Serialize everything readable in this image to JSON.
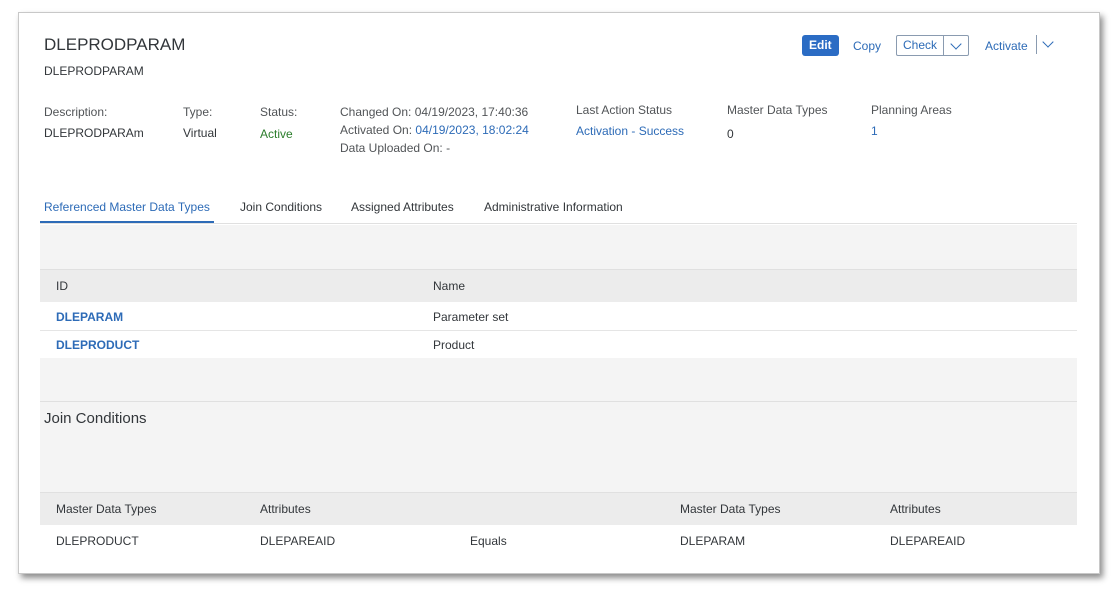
{
  "header": {
    "title": "DLEPRODPARAM",
    "subtitle": "DLEPRODPARAM"
  },
  "actions": {
    "edit": "Edit",
    "copy": "Copy",
    "check": "Check",
    "activate": "Activate"
  },
  "attributes": {
    "description_label": "Description:",
    "description_value": "DLEPRODPARAm",
    "type_label": "Type:",
    "type_value": "Virtual",
    "status_label": "Status:",
    "status_value": "Active",
    "changed_label": "Changed On:",
    "changed_value": "04/19/2023, 17:40:36",
    "activated_label": "Activated On:",
    "activated_value": "04/19/2023, 18:02:24",
    "uploaded_label": "Data Uploaded On:",
    "uploaded_value": "-",
    "last_action_label": "Last Action Status",
    "last_action_value": "Activation - Success",
    "mdt_label": "Master Data Types",
    "mdt_value": "0",
    "planning_label": "Planning Areas",
    "planning_value": "1"
  },
  "tabs": [
    {
      "label": "Referenced Master Data Types",
      "selected": true
    },
    {
      "label": "Join Conditions",
      "selected": false
    },
    {
      "label": "Assigned Attributes",
      "selected": false
    },
    {
      "label": "Administrative Information",
      "selected": false
    }
  ],
  "ref_table": {
    "columns": [
      "ID",
      "Name"
    ],
    "rows": [
      {
        "id": "DLEPARAM",
        "name": "Parameter set"
      },
      {
        "id": "DLEPRODUCT",
        "name": "Product"
      }
    ]
  },
  "join_section": {
    "title": "Join Conditions",
    "columns": [
      "Master Data Types",
      "Attributes",
      "Master Data Types",
      "Attributes"
    ],
    "rows": [
      {
        "mdt1": "DLEPRODUCT",
        "attr1": "DLEPAREAID",
        "op": "Equals",
        "mdt2": "DLEPARAM",
        "attr2": "DLEPAREAID"
      }
    ]
  },
  "colors": {
    "accent": "#2b6cc4",
    "link": "#2d6bb7",
    "status_active": "#2b7d2b"
  }
}
